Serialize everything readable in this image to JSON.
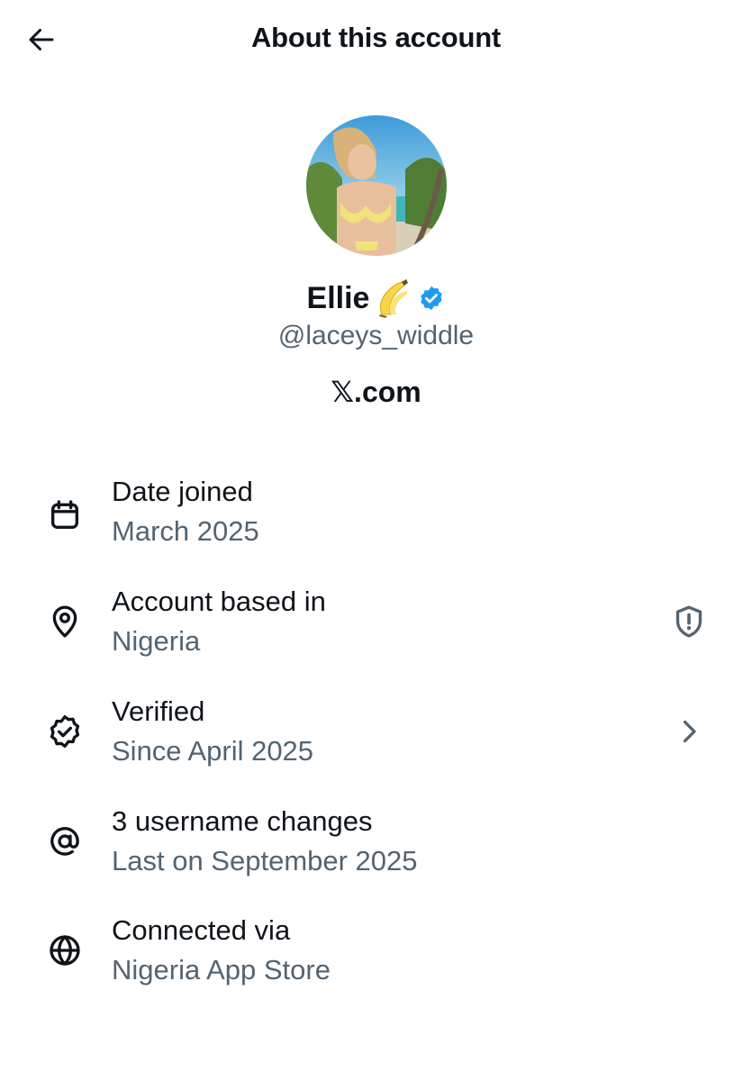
{
  "header": {
    "title": "About this account",
    "back_icon": "arrow-left-icon"
  },
  "profile": {
    "display_name": "Ellie",
    "name_emoji": "🍌",
    "verified_badge_color": "#1d9bf0",
    "handle": "@laceys_widdle",
    "site_mark": "𝕏",
    "site_suffix": ".com"
  },
  "details": [
    {
      "icon": "calendar-icon",
      "title": "Date joined",
      "value": "March 2025"
    },
    {
      "icon": "location-pin-icon",
      "title": "Account based in",
      "value": "Nigeria",
      "trailing_icon": "shield-alert-icon"
    },
    {
      "icon": "verified-check-icon",
      "title": "Verified",
      "value": "Since April 2025",
      "trailing_icon": "chevron-right-icon"
    },
    {
      "icon": "at-sign-icon",
      "title": "3 username changes",
      "value": "Last on September 2025"
    },
    {
      "icon": "globe-icon",
      "title": "Connected via",
      "value": "Nigeria App Store"
    }
  ],
  "colors": {
    "text_primary": "#0f1419",
    "text_secondary": "#536471",
    "accent": "#1d9bf0"
  }
}
